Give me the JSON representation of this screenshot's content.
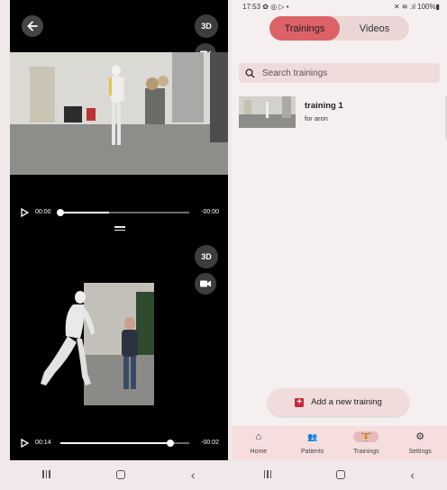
{
  "left": {
    "back_icon": "back-arrow-icon",
    "top_video": {
      "toggle_3d_label": "3D",
      "time_start": "00:00",
      "time_end": "-00:00",
      "progress": 0.0,
      "buffered": 0.38
    },
    "bottom_video": {
      "toggle_3d_label": "3D",
      "time_start": "00:14",
      "time_end": "-00:02",
      "progress": 0.85
    }
  },
  "status_bar": {
    "time": "17:53",
    "icons": "✿ ◎ ▷ •",
    "right": "✕ ≋ .ıl 100%▮"
  },
  "tabs": [
    {
      "label": "Trainings",
      "active": true
    },
    {
      "label": "Videos",
      "active": false
    }
  ],
  "search": {
    "placeholder": "Search trainings",
    "value": ""
  },
  "trainings": [
    {
      "title": "training 1",
      "subtitle": "for aron"
    }
  ],
  "add_button": {
    "label": "Add a new training",
    "icon": "+"
  },
  "bottom_nav": [
    {
      "label": "Home",
      "icon": "home-icon",
      "glyph": "⌂",
      "active": false
    },
    {
      "label": "Patients",
      "icon": "people-icon",
      "glyph": "👥",
      "active": false
    },
    {
      "label": "Trainings",
      "icon": "exercise-icon",
      "glyph": "🏋",
      "active": true
    },
    {
      "label": "Settings",
      "icon": "person-settings-icon",
      "glyph": "⚙",
      "active": false
    }
  ],
  "colors": {
    "accent": "#dc6268",
    "add_icon": "#c8263a",
    "background": "#f6efef"
  }
}
